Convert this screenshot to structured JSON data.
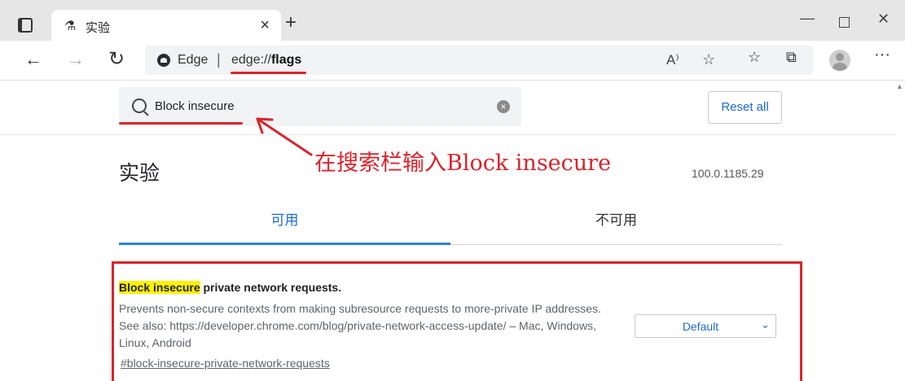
{
  "browser": {
    "tab_title": "实验",
    "tab_close": "×",
    "new_tab": "+",
    "window_min": "—",
    "window_close": "✕"
  },
  "address_bar": {
    "site_name": "Edge",
    "divider": "|",
    "url_prefix": "edge://",
    "url_bold": "flags",
    "read_aloud_icon": "A⁾"
  },
  "search": {
    "value": "Block insecure",
    "clear_icon": "×"
  },
  "reset_button": "Reset all",
  "annotation": "在搜索栏输入Block insecure",
  "page_title": "实验",
  "version": "100.0.1185.29",
  "tabs": {
    "available": "可用",
    "unavailable": "不可用"
  },
  "flag": {
    "title_highlight": "Block insecure",
    "title_rest": " private network requests.",
    "description": "Prevents non-secure contexts from making subresource requests to more-private IP addresses. See also: https://developer.chrome.com/blog/private-network-access-update/ – Mac, Windows, Linux, Android",
    "link": "#block-insecure-private-network-requests",
    "select_value": "Default"
  },
  "colors": {
    "accent": "#1a6bd0",
    "annotation_red": "#d9242b",
    "highlight": "#fff200"
  }
}
